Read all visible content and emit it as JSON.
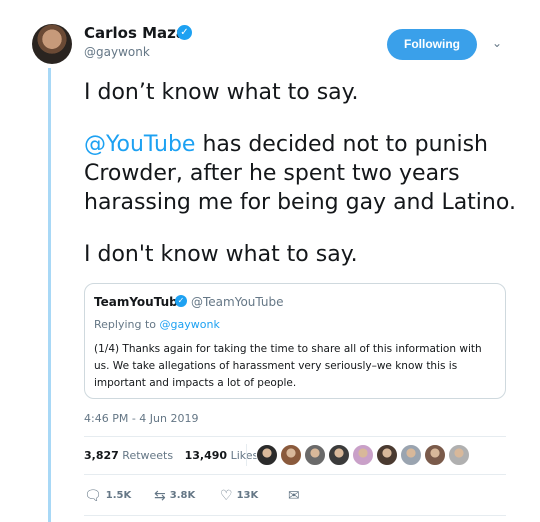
{
  "author": {
    "name": "Carlos Maza",
    "handle": "@gaywonk"
  },
  "follow_button": "Following",
  "tweet": {
    "line1": "I don’t know what to say.",
    "mention": "@YouTube",
    "line2_rest": " has decided not to punish Crowder, after he spent two years harassing me for being gay and Latino.",
    "line3": "I don't know what to say."
  },
  "quote": {
    "name": "TeamYouTube",
    "handle": "@TeamYouTube",
    "replying_prefix": "Replying to ",
    "replying_handle": "@gaywonk",
    "body": "(1/4) Thanks again for taking the time to share all of this information with us. We take allegations of harassment very seriously–we know this is important and impacts a lot of people."
  },
  "timestamp": "4:46 PM - 4 Jun 2019",
  "stats": {
    "retweets_count": "3,827",
    "retweets_label": "Retweets",
    "likes_count": "13,490",
    "likes_label": "Likes"
  },
  "likers": [
    {
      "color": "#2b2b2b"
    },
    {
      "color": "#8a5a3c"
    },
    {
      "color": "#6a6a6a"
    },
    {
      "color": "#3b3b3b"
    },
    {
      "color": "#c9a0c8"
    },
    {
      "color": "#4a3a30"
    },
    {
      "color": "#9aa4b0"
    },
    {
      "color": "#7a5a4a"
    },
    {
      "color": "#b0b0b0"
    }
  ],
  "actions": {
    "reply_count": "1.5K",
    "retweet_count": "3.8K",
    "like_count": "13K"
  },
  "colors": {
    "accent": "#1da1f2",
    "thread_line": "#a8d8f6"
  }
}
